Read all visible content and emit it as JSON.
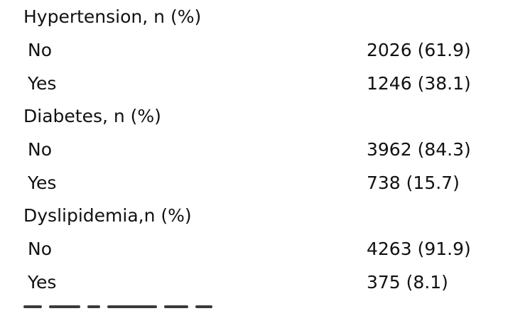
{
  "rows": [
    {
      "type": "header",
      "label": "Hypertension, n (%)",
      "value": ""
    },
    {
      "type": "sub",
      "label": "No",
      "value": "2026 (61.9)"
    },
    {
      "type": "sub",
      "label": "Yes",
      "value": "1246 (38.1)"
    },
    {
      "type": "header",
      "label": "Diabetes, n (%)",
      "value": ""
    },
    {
      "type": "sub",
      "label": "No",
      "value": "3962 (84.3)"
    },
    {
      "type": "sub",
      "label": "Yes",
      "value": "738 (15.7)"
    },
    {
      "type": "header",
      "label": "Dyslipidemia,n (%)",
      "value": ""
    },
    {
      "type": "sub",
      "label": "No",
      "value": "4263 (91.9)"
    },
    {
      "type": "sub",
      "label": "Yes",
      "value": "375 (8.1)"
    }
  ]
}
